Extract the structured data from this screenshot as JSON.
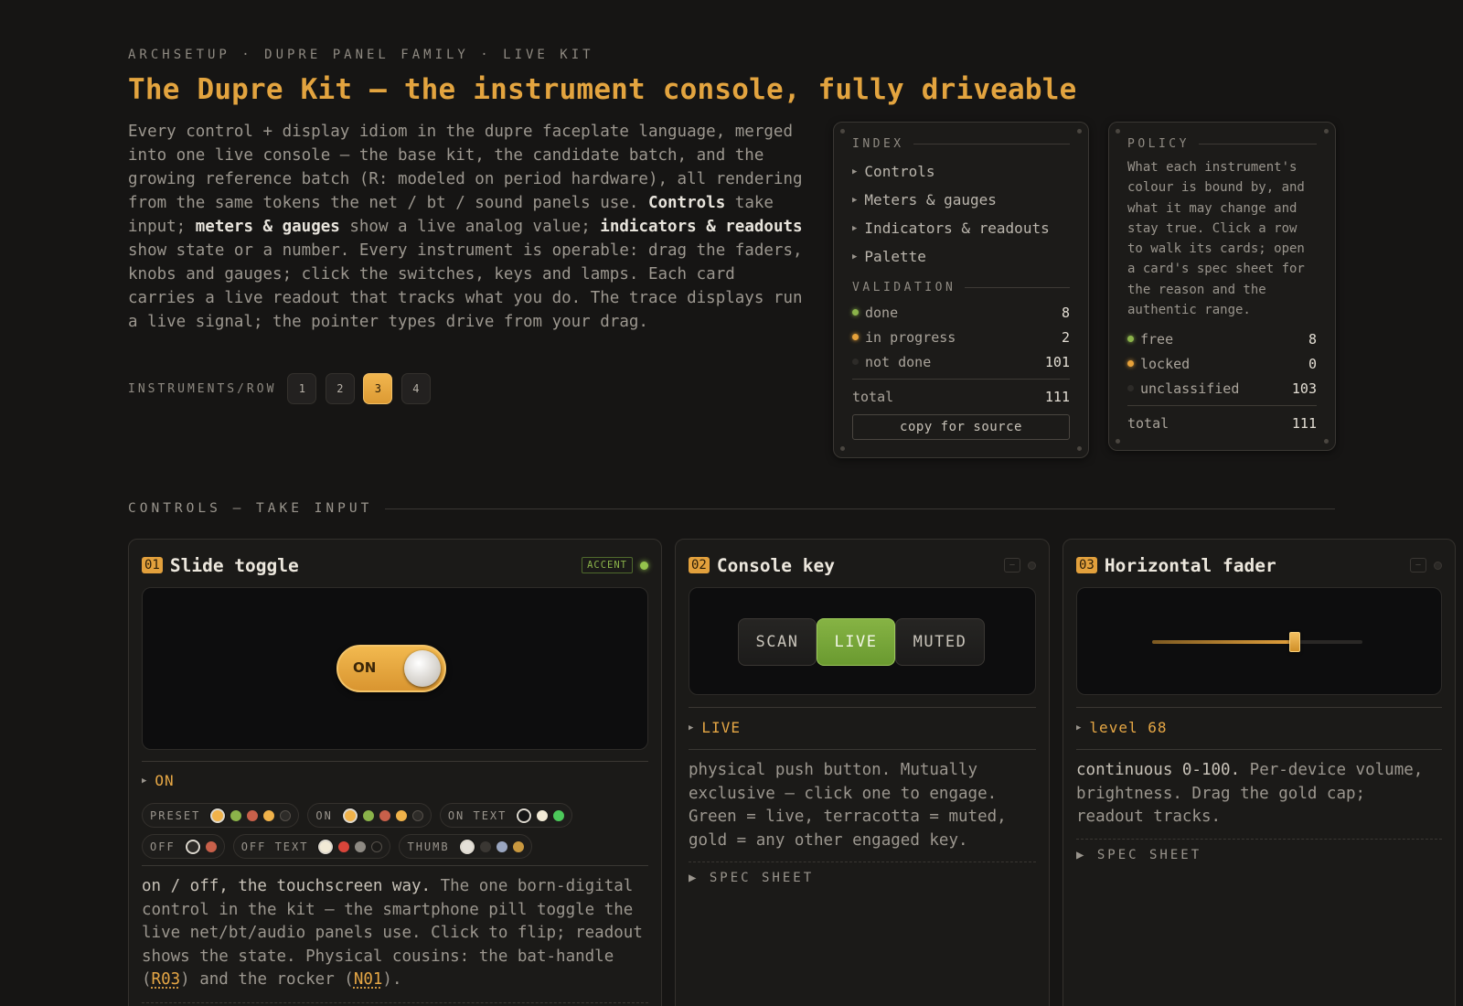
{
  "header": {
    "eyebrow": "ARCHSETUP · DUPRE PANEL FAMILY · LIVE KIT",
    "title": "The Dupre Kit — the instrument console, fully driveable",
    "intro": [
      {
        "t": "Every control + display idiom in the dupre faceplate language, merged into one live console — the base kit, the candidate batch, and the growing reference batch (R: modeled on period hardware), all rendering from the same tokens the net / bt / sound panels use. ",
        "b": false
      },
      {
        "t": "Controls",
        "b": true
      },
      {
        "t": " take input; ",
        "b": false
      },
      {
        "t": "meters & gauges",
        "b": true
      },
      {
        "t": " show a live analog value; ",
        "b": false
      },
      {
        "t": "indicators & readouts",
        "b": true
      },
      {
        "t": " show state or a number. Every instrument is operable: drag the faders, knobs and gauges; click the switches, keys and lamps. Each card carries a live readout that tracks what you do. The trace displays run a live signal; the pointer types drive from your drag.",
        "b": false
      }
    ],
    "per_row_label": "INSTRUMENTS/ROW",
    "per_row_options": [
      "1",
      "2",
      "3",
      "4"
    ],
    "per_row_selected": "3"
  },
  "index_panel": {
    "heading": "INDEX",
    "items": [
      "Controls",
      "Meters & gauges",
      "Indicators & readouts",
      "Palette"
    ],
    "validation_heading": "VALIDATION",
    "rows": [
      {
        "label": "done",
        "value": "8",
        "color": "#8bb34a"
      },
      {
        "label": "in progress",
        "value": "2",
        "color": "#e6a13a"
      },
      {
        "label": "not done",
        "value": "101",
        "color": "#2d2b28"
      }
    ],
    "total_label": "total",
    "total_value": "111",
    "copy_button": "copy for source"
  },
  "policy_panel": {
    "heading": "POLICY",
    "text": "What each instrument's colour is bound by, and what it may change and stay true. Click a row to walk its cards; open a card's spec sheet for the reason and the authentic range.",
    "rows": [
      {
        "label": "free",
        "value": "8",
        "color": "#8bb34a"
      },
      {
        "label": "locked",
        "value": "0",
        "color": "#e6a13a"
      },
      {
        "label": "unclassified",
        "value": "103",
        "color": "#2d2b28"
      }
    ],
    "total_label": "total",
    "total_value": "111"
  },
  "section": {
    "title": "CONTROLS — TAKE INPUT"
  },
  "cards": [
    {
      "num": "01",
      "title": "Slide toggle",
      "badge": "ACCENT",
      "toggle_label": "ON",
      "toggle_on": true,
      "readout": "ON",
      "chips": [
        {
          "label": "PRESET",
          "swatches": [
            "#f0b24a",
            "#8bb34a",
            "#c8604a",
            "#f0b24a",
            "#2d2b28"
          ],
          "selected": 0
        },
        {
          "label": "ON",
          "swatches": [
            "#f0b24a",
            "#8bb34a",
            "#c8604a",
            "#f0b24a",
            "#2d2b28"
          ],
          "selected": 0
        },
        {
          "label": "ON TEXT",
          "swatches": [
            "#151515",
            "#f2ead6",
            "#4cc95a"
          ],
          "selected": 0
        },
        {
          "label": "OFF",
          "swatches": [
            "#2d2b28",
            "#c8604a"
          ],
          "selected": 0
        },
        {
          "label": "OFF TEXT",
          "swatches": [
            "#f2ead6",
            "#d9453a",
            "#8e8a83",
            "#1b1a18"
          ],
          "selected": 0
        },
        {
          "label": "THUMB",
          "swatches": [
            "#e4e0d8",
            "#3a3733",
            "#9aa6c0",
            "#c9983f"
          ],
          "selected": 0
        }
      ],
      "desc_lead": "on / off, the touchscreen way.",
      "desc_body": " The one born-digital control in the kit — the smartphone pill toggle the live net/bt/audio panels use. Click to flip; readout shows the state. Physical cousins: the bat-handle (",
      "ref1": "R03",
      "desc_mid": ") and the rocker (",
      "ref2": "N01",
      "desc_end": ")."
    },
    {
      "num": "02",
      "title": "Console key",
      "keys": [
        "SCAN",
        "LIVE",
        "MUTED"
      ],
      "active_key": "LIVE",
      "readout": "LIVE",
      "desc_lead": "physical push button.",
      "desc_body": " Mutually exclusive — click one to engage. Green = live, terracotta = muted, gold = any other engaged key.",
      "spec": "SPEC SHEET"
    },
    {
      "num": "03",
      "title": "Horizontal fader",
      "level": 68,
      "readout": "level 68",
      "desc_lead": "continuous 0-100.",
      "desc_body": " Per-device volume, brightness. Drag the gold cap; readout tracks.",
      "spec": "SPEC SHEET"
    }
  ]
}
